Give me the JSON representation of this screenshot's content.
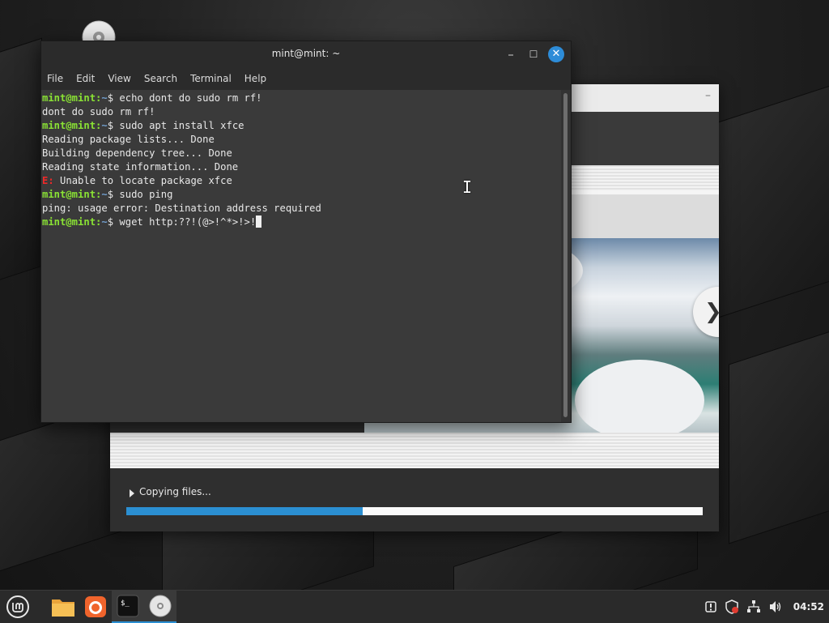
{
  "terminal": {
    "title": "mint@mint: ~",
    "menu": [
      "File",
      "Edit",
      "View",
      "Search",
      "Terminal",
      "Help"
    ],
    "prompt_user": "mint@mint",
    "prompt_sep": ":",
    "prompt_dir": "~",
    "prompt_end": "$ ",
    "lines": [
      {
        "type": "cmd",
        "text": "echo dont do sudo rm rf!"
      },
      {
        "type": "out",
        "text": "dont do sudo rm rf!"
      },
      {
        "type": "cmd",
        "text": "sudo apt install xfce"
      },
      {
        "type": "out",
        "text": "Reading package lists... Done"
      },
      {
        "type": "out",
        "text": "Building dependency tree... Done"
      },
      {
        "type": "out",
        "text": "Reading state information... Done"
      },
      {
        "type": "err",
        "prefix": "E:",
        "text": " Unable to locate package xfce"
      },
      {
        "type": "cmd",
        "text": "sudo ping"
      },
      {
        "type": "out",
        "text": "ping: usage error: Destination address required"
      },
      {
        "type": "cmd",
        "text": "wget http:??!(@>!^*>!>!",
        "cursor": true
      }
    ]
  },
  "installer": {
    "status_text": "Copying files...",
    "progress": 0.41
  },
  "taskbar": {
    "clock": "04:52",
    "apps": [
      "menu-icon",
      "files-icon",
      "firefox-icon",
      "terminal-icon",
      "disc-icon"
    ]
  },
  "colors": {
    "accent": "#2b8fd2",
    "prompt_green": "#8ae234",
    "prompt_blue": "#729fcf",
    "error_red": "#ef2929"
  }
}
